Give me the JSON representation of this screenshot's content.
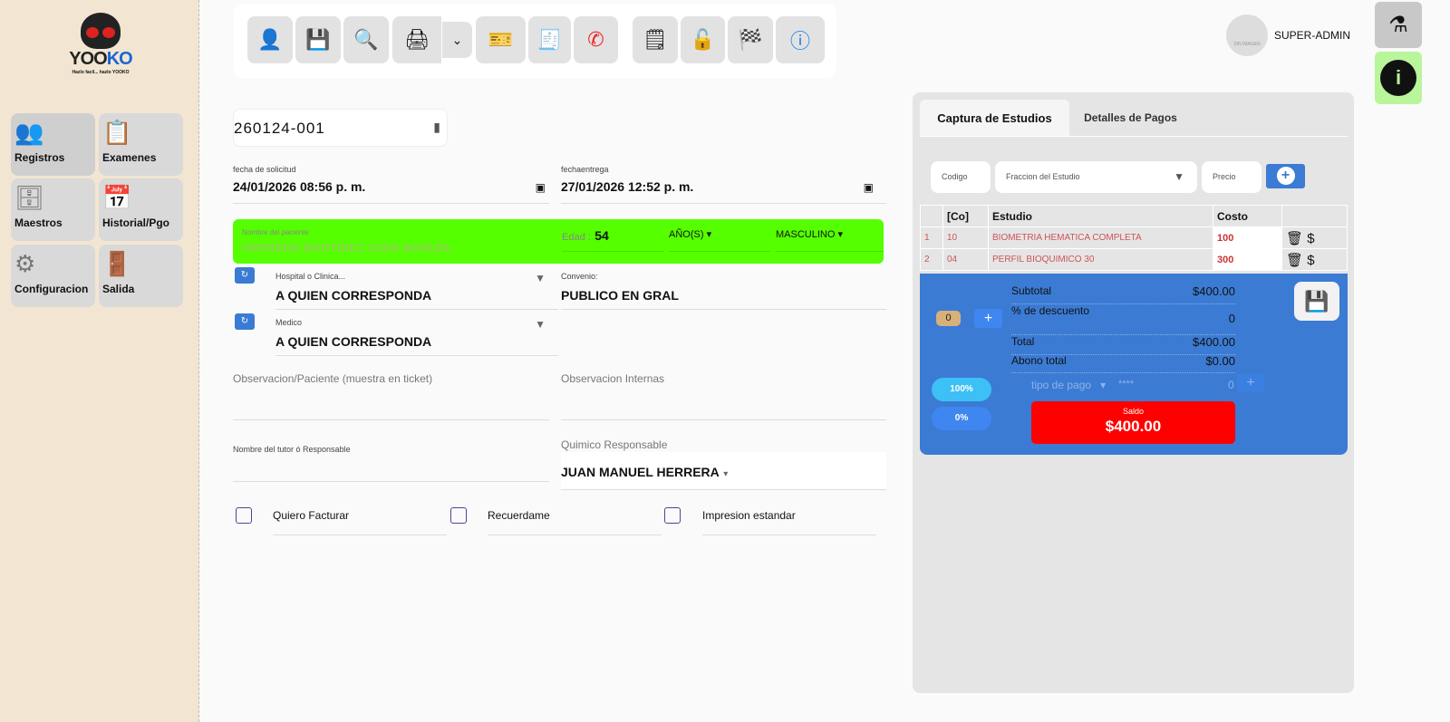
{
  "brand": {
    "name_a": "YOO",
    "name_b": "KO",
    "tagline": "Hazlo facil... hazlo YOOKO"
  },
  "sidebar": {
    "items": [
      {
        "label": "Registros",
        "icon": "user-add-icon"
      },
      {
        "label": "Examenes",
        "icon": "clipboard-icon"
      },
      {
        "label": "Maestros",
        "icon": "database-icon"
      },
      {
        "label": "Historial/Pgo",
        "icon": "calendar-clock-icon"
      },
      {
        "label": "Configuracion",
        "icon": "gears-icon"
      },
      {
        "label": "Salida",
        "icon": "door-icon"
      }
    ]
  },
  "toolbar": [
    "user-icon",
    "save-icon",
    "search-zoom-icon",
    "print-icon",
    "chevron-down-icon",
    "ticket-icon",
    "receipt-icon",
    "whatsapp-icon",
    "note-icon",
    "unlock-icon",
    "flag-icon",
    "help-icon"
  ],
  "user": {
    "avatar_text": "SIN IMAGEN",
    "name": "SUPER-ADMIN"
  },
  "form": {
    "folio": "260124-001",
    "fecha_solicitud_label": "fecha de solicitud",
    "fecha_solicitud": "24/01/2026 08:56 p. m.",
    "fecha_entrega_label": "fechaentrega",
    "fecha_entrega": "27/01/2026 12:52 p. m.",
    "paciente_label": "Nombre del paciente",
    "paciente": "HERRERA MARTINEZ JUAN MANUEL",
    "edad_label": "Edad :",
    "edad": "54",
    "unidad": "AÑO(S)",
    "sexo": "MASCULINO",
    "hospital_label": "Hospital o Clinica...",
    "hospital": "A QUIEN CORRESPONDA",
    "convenio_label": "Convenio:",
    "convenio": "PUBLICO EN GRAL",
    "medico_label": "Medico",
    "medico": "A QUIEN CORRESPONDA",
    "obs_paciente": "Observacion/Paciente (muestra en ticket)",
    "obs_internas": "Observacion Internas",
    "tutor": "Nombre del tutor ó Responsable",
    "quimico_label": "Quimico Responsable",
    "quimico": "JUAN MANUEL HERRERA",
    "checks": [
      "Quiero Facturar",
      "Recuerdame",
      "Impresion estandar"
    ]
  },
  "panel": {
    "tabs": [
      "Captura de Estudios",
      "Detalles de Pagos"
    ],
    "codigo": "Codigo",
    "fraccion": "Fraccion del Estudio",
    "precio": "Precio",
    "headers": [
      "[Co]",
      "Estudio",
      "Costo"
    ],
    "rows": [
      {
        "n": "1",
        "code": "10",
        "name": "BIOMETRIA HEMATICA COMPLETA",
        "cost": "100"
      },
      {
        "n": "2",
        "code": "04",
        "name": "PERFIL BIOQUIMICO 30",
        "cost": "300"
      }
    ],
    "discount_count": "0",
    "subtotal_label": "Subtotal",
    "subtotal": "$400.00",
    "desc_label": "% de descuento",
    "desc": "0",
    "total_label": "Total",
    "total": "$400.00",
    "abono_label": "Abono total",
    "abono": "$0.00",
    "tipo_pago": "tipo de pago",
    "stars": "****",
    "pago_monto": "0",
    "pct100": "100%",
    "pct0": "0%",
    "saldo_label": "Saldo",
    "saldo": "$400.00"
  },
  "colors": {
    "patient_bg": "#55ff00",
    "saldo_bg": "#ff0000",
    "summary_bg": "#3b7bd4",
    "sidebar_bg": "#f2e6d2"
  }
}
